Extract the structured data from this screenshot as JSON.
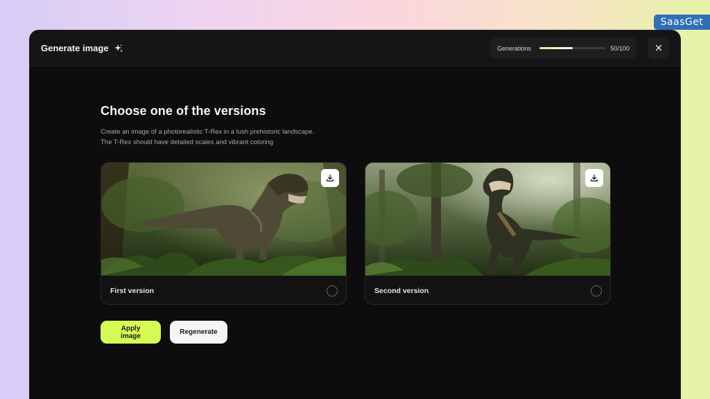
{
  "watermark": {
    "text": "SaasGet"
  },
  "header": {
    "title": "Generate image",
    "title_icon": "sparkle-icon",
    "generations": {
      "label": "Generations",
      "used": 50,
      "total": 100,
      "count_text": "50/100",
      "progress_fraction": 0.5
    },
    "close_icon": "close-icon"
  },
  "main": {
    "heading": "Choose one of the versions",
    "description_line1": "Create an image of a photorealistic T-Rex in a lush prehistoric landscape.",
    "description_line2": "The T-Rex should have detailed scales and vibrant coloring",
    "cards": [
      {
        "label": "First version",
        "image": "t-rex-walking-jungle",
        "download_icon": "download-icon",
        "selected": false
      },
      {
        "label": "Second version",
        "image": "t-rex-roaring-forest",
        "download_icon": "download-icon",
        "selected": false
      }
    ],
    "actions": {
      "apply_label": "Apply image",
      "regenerate_label": "Regenerate"
    }
  },
  "colors": {
    "accent": "#d7fb55",
    "modal_bg": "#0d0d0d",
    "header_bg": "#151515",
    "watermark_bg": "#2f6fb7"
  }
}
